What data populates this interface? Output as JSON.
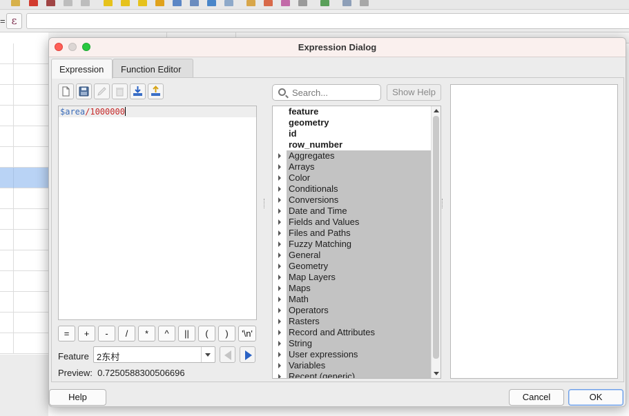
{
  "dialog": {
    "title": "Expression Dialog"
  },
  "tabs": [
    {
      "label": "Expression",
      "active": true
    },
    {
      "label": "Function Editor",
      "active": false
    }
  ],
  "background": {
    "eq_label": "=",
    "epsilon_label": "ε"
  },
  "editor": {
    "expression_var": "$area",
    "expression_rest": "/1000000"
  },
  "operators": [
    "=",
    "+",
    "-",
    "/",
    "*",
    "^",
    "||",
    "(",
    ")",
    "'\\n'"
  ],
  "feature": {
    "label": "Feature",
    "value": "2东村"
  },
  "preview": {
    "label": "Preview:",
    "value": "0.7250588300506696"
  },
  "search": {
    "placeholder": "Search..."
  },
  "show_help_label": "Show Help",
  "tree": {
    "fields": [
      "feature",
      "geometry",
      "id",
      "row_number"
    ],
    "groups": [
      "Aggregates",
      "Arrays",
      "Color",
      "Conditionals",
      "Conversions",
      "Date and Time",
      "Fields and Values",
      "Files and Paths",
      "Fuzzy Matching",
      "General",
      "Geometry",
      "Map Layers",
      "Maps",
      "Math",
      "Operators",
      "Rasters",
      "Record and Attributes",
      "String",
      "User expressions",
      "Variables",
      "Recent (generic)"
    ]
  },
  "buttons": {
    "help": "Help",
    "cancel": "Cancel",
    "ok": "OK"
  },
  "colors": {
    "group_highlight": "#c3c3c3",
    "selected_row": "#b9d3f5",
    "close": "#ff5f57",
    "maximize": "#28c840",
    "expr_variable": "#3a6bb8",
    "expr_number": "#c62828"
  }
}
